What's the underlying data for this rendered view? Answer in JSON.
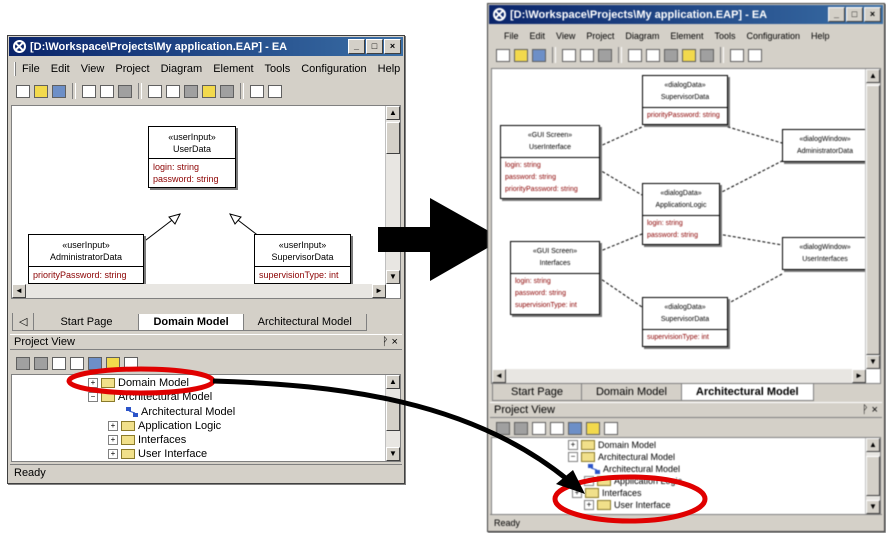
{
  "left_window": {
    "title": "[D:\\Workspace\\Projects\\My application.EAP] - EA",
    "menu": [
      "File",
      "Edit",
      "View",
      "Project",
      "Diagram",
      "Element",
      "Tools",
      "Configuration",
      "Help"
    ],
    "classes": [
      {
        "stereotype": "«userInput»",
        "name": "UserData",
        "attributes": [
          "login:  string",
          "password:  string"
        ]
      },
      {
        "stereotype": "«userInput»",
        "name": "AdministratorData",
        "attributes": [
          "priorityPassword:  string"
        ]
      },
      {
        "stereotype": "«userInput»",
        "name": "SupervisorData",
        "attributes": [
          "supervisionType:  int"
        ]
      }
    ],
    "tabs": [
      "Start Page",
      "Domain Model",
      "Architectural Model"
    ],
    "project_view_title": "Project View",
    "tree": [
      "Domain Model",
      "Architectural Model",
      "Architectural Model",
      "Application Logic",
      "Interfaces",
      "User Interface"
    ],
    "status": "Ready"
  },
  "right_window": {
    "title": "[D:\\Workspace\\Projects\\My application.EAP] - EA",
    "menu": [
      "File",
      "Edit",
      "View",
      "Project",
      "Diagram",
      "Element",
      "Tools",
      "Configuration",
      "Help"
    ],
    "classes": [
      {
        "stereotype": "«dialogData»",
        "name": "SupervisorData",
        "attributes": [
          "priorityPassword: string"
        ]
      },
      {
        "stereotype": "«GUI Screen»",
        "name": "UserInterface",
        "attributes": [
          "login: string",
          "password: string",
          "priorityPassword: string"
        ]
      },
      {
        "stereotype": "«dialogWindow»",
        "name": "AdministratorData",
        "attributes": []
      },
      {
        "stereotype": "«dialogData»",
        "name": "ApplicationLogic",
        "attributes": [
          "login: string",
          "password: string"
        ]
      },
      {
        "stereotype": "«GUI Screen»",
        "name": "Interfaces",
        "attributes": [
          "login: string",
          "password: string",
          "supervisionType: int"
        ]
      },
      {
        "stereotype": "«dialogWindow»",
        "name": "UserInterfaces",
        "attributes": []
      },
      {
        "stereotype": "«dialogData»",
        "name": "SupervisorData",
        "attributes": [
          "supervisionType: int"
        ]
      }
    ],
    "tabs": [
      "Start Page",
      "Domain Model",
      "Architectural Model"
    ],
    "project_view_title": "Project View",
    "tree": [
      "Domain Model",
      "Architectural Model",
      "Architectural Model",
      "Application Logic",
      "Interfaces",
      "User Interface"
    ],
    "status": "Ready"
  },
  "annotation_color": "#e00000"
}
